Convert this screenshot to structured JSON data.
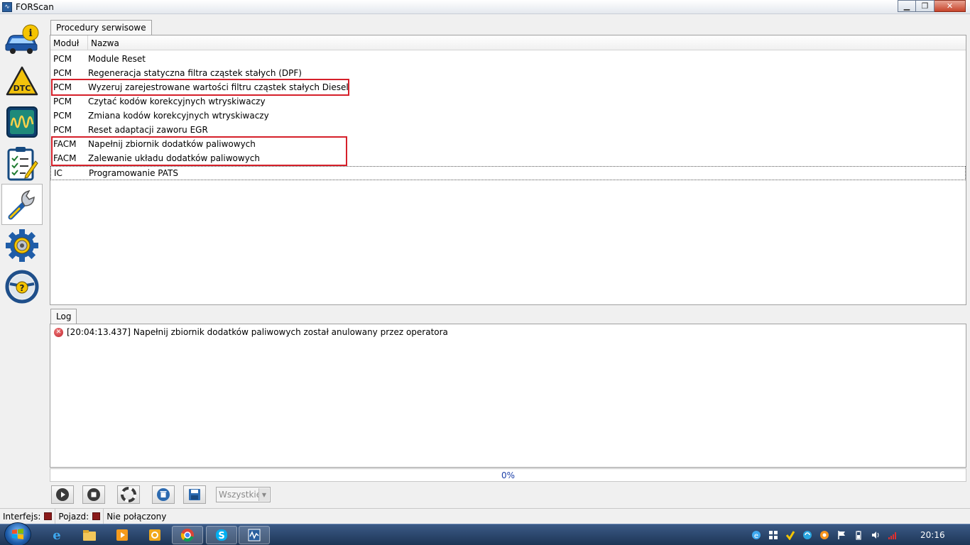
{
  "window": {
    "title": "FORScan",
    "minimize": "▁",
    "maximize": "❐",
    "close": "✕"
  },
  "sidebar": {
    "items": [
      {
        "name": "vehicle-info-icon"
      },
      {
        "name": "dtc-icon"
      },
      {
        "name": "oscilloscope-icon"
      },
      {
        "name": "checklist-icon"
      },
      {
        "name": "wrench-icon"
      },
      {
        "name": "settings-gear-icon"
      },
      {
        "name": "help-wheel-icon"
      }
    ]
  },
  "procedures": {
    "tab_label": "Procedury serwisowe",
    "col_module": "Moduł",
    "col_name": "Nazwa",
    "rows": [
      {
        "module": "PCM",
        "name": "Module Reset"
      },
      {
        "module": "PCM",
        "name": "Regeneracja statyczna filtra cząstek stałych (DPF)"
      },
      {
        "module": "PCM",
        "name": "Wyzeruj zarejestrowane wartości filtru cząstek stałych Diesel"
      },
      {
        "module": "PCM",
        "name": "Czytać kodów korekcyjnych wtryskiwaczy"
      },
      {
        "module": "PCM",
        "name": "Zmiana kodów korekcyjnych wtryskiwaczy"
      },
      {
        "module": "PCM",
        "name": "Reset adaptacji zaworu EGR"
      },
      {
        "module": "FACM",
        "name": "Napełnij zbiornik dodatków paliwowych"
      },
      {
        "module": "FACM",
        "name": "Zalewanie układu dodatków paliwowych"
      },
      {
        "module": "IC",
        "name": "Programowanie PATS"
      }
    ]
  },
  "log": {
    "tab_label": "Log",
    "entries": [
      {
        "text": "[20:04:13.437] Napełnij zbiornik dodatków paliwowych został anulowany przez operatora",
        "icon": "error-icon"
      }
    ]
  },
  "progress": {
    "label": "0%",
    "value": 0
  },
  "toolbar": {
    "buttons": [
      "play-button",
      "stop-button",
      "lifebuoy-button",
      "delete-button",
      "save-button"
    ],
    "filter_value": "Wszystkie"
  },
  "status": {
    "interface_label": "Interfejs:",
    "vehicle_label": "Pojazd:",
    "connection": "Nie połączony"
  },
  "taskbar": {
    "clock": "20:16"
  },
  "colors": {
    "highlight_red": "#d6202a",
    "progress_text": "#1c3fa8",
    "led_off": "#8a1a1a"
  }
}
